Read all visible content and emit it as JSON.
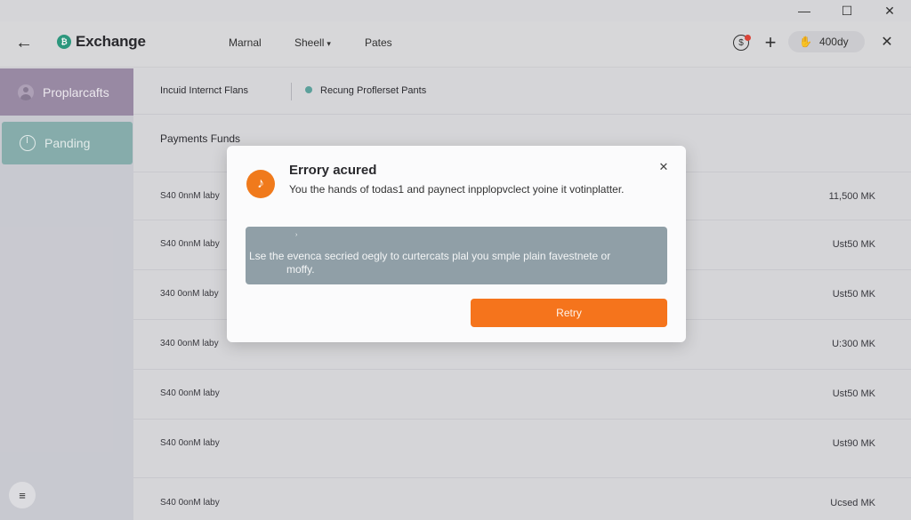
{
  "window": {
    "minimize_icon": "minimize-icon",
    "maximize_icon": "maximize-icon",
    "close_icon": "close-icon"
  },
  "header": {
    "app_name": "Exchange",
    "nav": [
      "Marnal",
      "Sheell",
      "Pates"
    ],
    "account_label": "400dy",
    "accent": "#2e9c82"
  },
  "sidebar": {
    "items": [
      {
        "label": "Proplarcafts",
        "icon": "avatar-icon",
        "color": "#9d8ea9"
      },
      {
        "label": "Panding",
        "icon": "power-icon",
        "color": "#8bb2b1"
      }
    ]
  },
  "subbar": {
    "item1": "Incuid Internct Flans",
    "item2": "Recung Proflerset Pants"
  },
  "main": {
    "section_title": "Payments Funds",
    "rows": [
      {
        "label": "S40 0nnM laby",
        "value": "11,500 MK"
      },
      {
        "label": "S40 0nnM laby",
        "value": "Ust50 MK"
      },
      {
        "label": "340 0onM laby",
        "value": "Ust50 MK"
      },
      {
        "label": "340 0onM laby",
        "value": "U:300 MK"
      },
      {
        "label": "S40 0onM laby",
        "value": "Ust50 MK"
      },
      {
        "label": "S40 0onM laby",
        "value": "Ust90 MK"
      },
      {
        "label": "S40 0onM laby",
        "value": "Ucsed MK"
      }
    ]
  },
  "dialog": {
    "title": "Errory acured",
    "message": "You the hands of todas1 and paynect inpplopvclect yoine it votinplatter.",
    "detail_mark": "›",
    "detail_line1": "Lse the evenca secried oegly to curtercats plal you smple plain favestnete or",
    "detail_line2": "moffy.",
    "button": "Retry",
    "accent": "#f5741c"
  }
}
